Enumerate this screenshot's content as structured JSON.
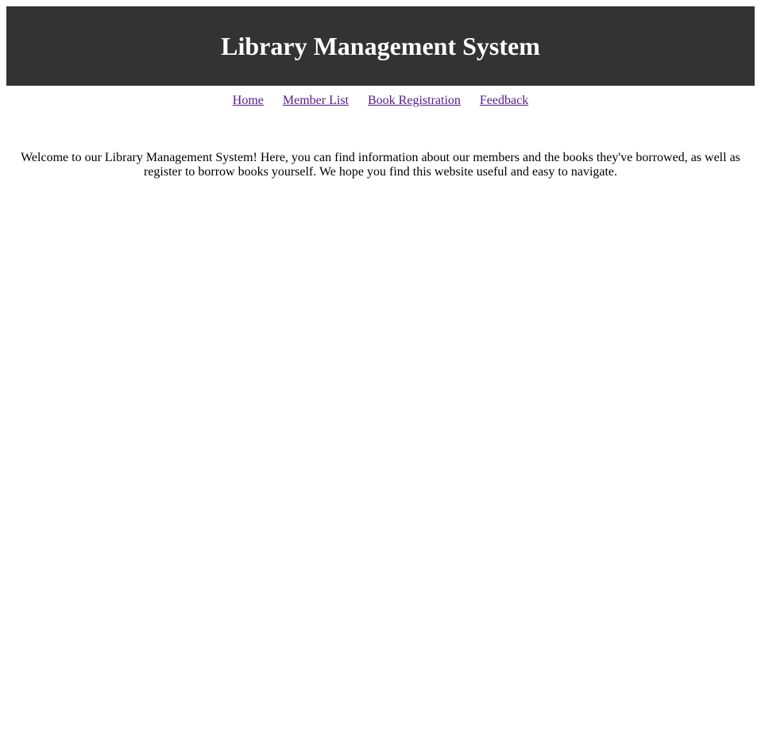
{
  "header": {
    "title": "Library Management System"
  },
  "nav": {
    "items": [
      {
        "label": "Home"
      },
      {
        "label": "Member List"
      },
      {
        "label": "Book Registration"
      },
      {
        "label": "Feedback"
      }
    ]
  },
  "main": {
    "welcome_text": "Welcome to our Library Management System! Here, you can find information about our members and the books they've borrowed, as well as register to borrow books yourself. We hope you find this website useful and easy to navigate."
  },
  "colors": {
    "header_background": "#333333",
    "header_text": "#ffffff",
    "link_visited": "#551a8b"
  }
}
